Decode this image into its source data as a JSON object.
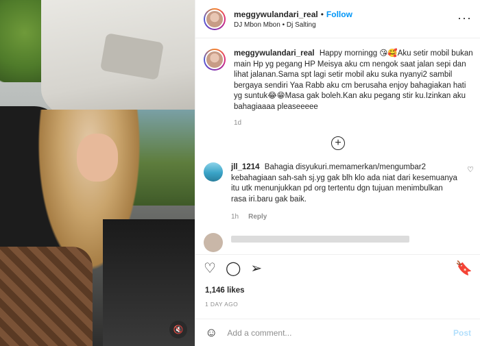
{
  "media": {
    "mute_icon": "speaker-muted-icon",
    "mute_symbol": "🔇"
  },
  "header": {
    "username": "meggywulandari_real",
    "separator": "•",
    "follow_label": "Follow",
    "audio": "DJ Mbon Mbon • Dj Salting",
    "more_icon": "more-options-icon",
    "more_symbol": "···"
  },
  "caption": {
    "username": "meggywulandari_real",
    "text": "Happy morningg 😘🥰Aku setir mobil bukan main Hp yg pegang HP Meisya aku cm nengok saat jalan sepi dan lihat jalanan.Sama spt lagi setir mobil aku suka nyanyi2 sambil bergaya sendiri Yaa Rabb aku cm berusaha enjoy bahagiakan hati yg suntuk😂😁Masa gak boleh.Kan aku pegang stir ku.Izinkan aku bahagiaaaa pleaseeeee",
    "time": "1d"
  },
  "load_more": {
    "icon": "plus-circle-icon",
    "symbol": "+"
  },
  "comment": {
    "username": "jll_1214",
    "text": "Bahagia disyukuri.memamerkan/mengumbar2 kebahagiaan sah-sah sj.yg gak blh klo ada niat dari kesemuanya itu utk menunjukkan pd org tertentu dgn tujuan menimbulkan rasa iri.baru gak baik.",
    "time": "1h",
    "reply_label": "Reply",
    "like_icon": "heart-outline-icon",
    "like_symbol": "♡"
  },
  "actions": {
    "like_symbol": "♡",
    "comment_symbol": "◯",
    "share_symbol": "➢",
    "save_symbol": "🔖"
  },
  "likes": "1,146 likes",
  "date": "1 DAY AGO",
  "add_comment": {
    "emoji_symbol": "☺",
    "placeholder": "Add a comment...",
    "post_label": "Post"
  },
  "colors": {
    "accent": "#0095f6",
    "muted": "#8e8e8e",
    "post_disabled": "#b2dffc"
  }
}
